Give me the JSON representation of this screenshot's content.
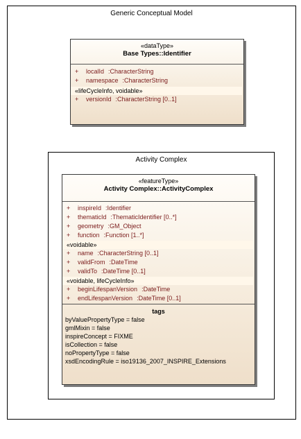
{
  "outer_package": {
    "title": "Generic Conceptual Model"
  },
  "base_types_class": {
    "stereotype": "«dataType»",
    "name": "Base Types::Identifier",
    "attributes": [
      {
        "vis": "+",
        "name": "localId",
        "type": ":CharacterString"
      },
      {
        "vis": "+",
        "name": "namespace",
        "type": ":CharacterString"
      }
    ],
    "group_label": "«lifeCycleInfo, voidable»",
    "group_attributes": [
      {
        "vis": "+",
        "name": "versionId",
        "type": ":CharacterString [0..1]"
      }
    ]
  },
  "activity_package": {
    "title": "Activity Complex"
  },
  "activity_class": {
    "stereotype": "«featureType»",
    "name": "Activity Complex::ActivityComplex",
    "attributes": [
      {
        "vis": "+",
        "name": "inspireId",
        "type": ":Identifier"
      },
      {
        "vis": "+",
        "name": "thematicId",
        "type": ":ThematicIdentifier [0..*]"
      },
      {
        "vis": "+",
        "name": "geometry",
        "type": ":GM_Object"
      },
      {
        "vis": "+",
        "name": "function",
        "type": ":Function [1..*]"
      }
    ],
    "voidable_label": "«voidable»",
    "voidable_attributes": [
      {
        "vis": "+",
        "name": "name",
        "type": ":CharacterString [0..1]"
      },
      {
        "vis": "+",
        "name": "validFrom",
        "type": ":DateTime"
      },
      {
        "vis": "+",
        "name": "validTo",
        "type": ":DateTime [0..1]"
      }
    ],
    "lifecycle_label": "«voidable, lifeCycleInfo»",
    "lifecycle_attributes": [
      {
        "vis": "+",
        "name": "beginLifespanVersion",
        "type": ":DateTime"
      },
      {
        "vis": "+",
        "name": "endLifespanVersion",
        "type": ":DateTime [0..1]"
      }
    ],
    "tags_title": "tags",
    "tags": [
      "byValuePropertyType = false",
      "gmlMixin = false",
      "inspireConcept = FIXME",
      "isCollection = false",
      "noPropertyType = false",
      "xsdEncodingRule = iso19136_2007_INSPIRE_Extensions"
    ]
  }
}
